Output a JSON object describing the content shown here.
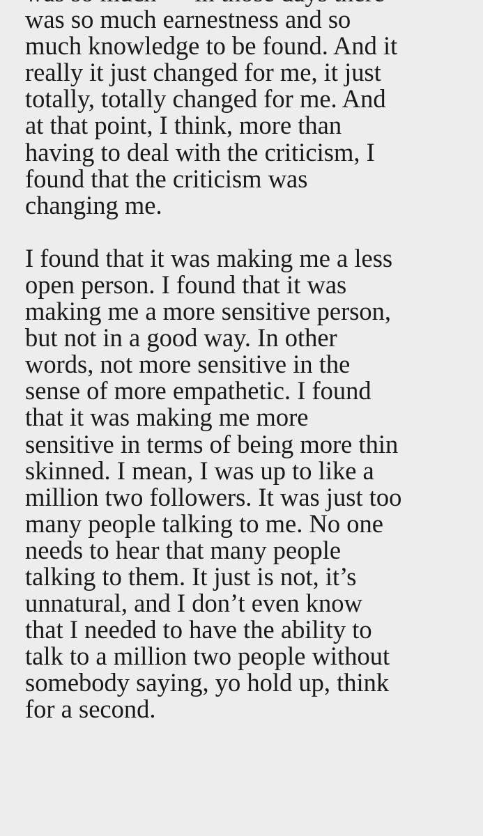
{
  "article": {
    "paragraphs": [
      {
        "lines": [
          "was so much — in those days there",
          "was so much earnestness and so",
          "much knowledge to be found. And it",
          "really it just changed for me, it just",
          "totally, totally changed for me. And",
          "at that point, I think, more than",
          "having to deal with the criticism, I",
          "found that the criticism was",
          "changing me."
        ]
      },
      {
        "lines": [
          "I found that it was making me a less",
          "open person. I found that it was",
          "making me a more sensitive person,",
          "but not in a good way. In other",
          "words, not more sensitive in the",
          "sense of more empathetic. I found",
          "that it was making me more",
          "sensitive in terms of being more thin",
          "skinned. I mean, I was up to like a",
          "million two followers. It was just too",
          "many people talking to me. No one",
          "needs to hear that many people",
          "talking to them. It just is not, it’s",
          "unnatural, and I don’t even know",
          "that I needed to have the ability to",
          "talk to a million two people without",
          "somebody saying, yo hold up, think",
          "for a second."
        ]
      }
    ]
  }
}
